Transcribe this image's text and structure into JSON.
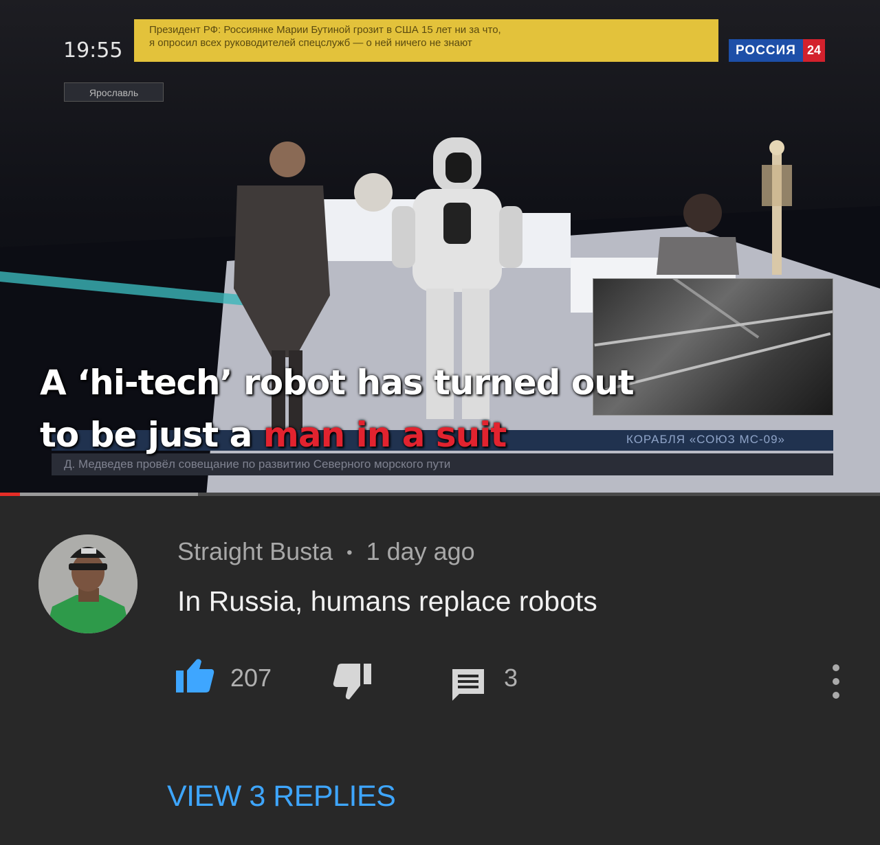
{
  "video": {
    "clock": "19:55",
    "ticker_top": [
      "Президент РФ: Россиянке Марии Бутиной грозит в США 15 лет ни за что,",
      "я опросил всех руководителей спецслужб — о ней ничего не знают"
    ],
    "city": "Ярославль",
    "channel_name": "РОССИЯ",
    "channel_number": "24",
    "lower_band_text": "КОРАБЛЯ «СОЮЗ МС-09»",
    "lower_ticker": "Д. Медведев провёл совещание по развитию Северного морского пути",
    "caption_line1": "A ‘hi-tech’ robot has turned out",
    "caption_line2_white": "to be just a ",
    "caption_line2_red": "man in a suit",
    "progress_played_fraction": 0.023,
    "progress_buffered_fraction": 0.225
  },
  "comment": {
    "author": "Straight Busta",
    "separator": "•",
    "time": "1 day ago",
    "text": "In Russia, humans replace robots",
    "like_count": "207",
    "reply_count": "3",
    "view_replies_label": "VIEW 3 REPLIES"
  },
  "icons": {
    "like": "thumbs-up-icon",
    "dislike": "thumbs-down-icon",
    "reply": "comment-icon",
    "more": "more-vert-icon"
  },
  "colors": {
    "background": "#282828",
    "like_blue": "#3ea6ff",
    "link_blue": "#3ea6ff",
    "progress_red": "#e52d27",
    "caption_red": "#e2232f"
  }
}
